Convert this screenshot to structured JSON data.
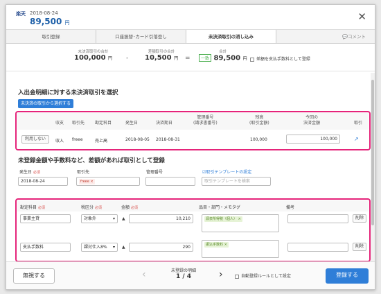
{
  "header": {
    "bank": "楽天",
    "date": "2018-08-24",
    "amount": "89,500",
    "unit": "円"
  },
  "tabs": [
    "取引登録",
    "口座振替･カード引落登し",
    "未決済取引の消し込み",
    "コメント"
  ],
  "summary": {
    "l1": "未決済取引の合計",
    "v1": "100,000",
    "l2": "差額取引の合計",
    "v2": "10,500",
    "l3": "合計",
    "v3": "89,500",
    "badge": "一致",
    "unit": "円",
    "op_minus": "-",
    "op_eq": "=",
    "check": "差額を支払手数料として登録"
  },
  "section1": {
    "title": "入出金明細に対する未決済取引を選択",
    "select_button": "未決済の取引から選択する",
    "columns": [
      "収支",
      "取引先",
      "勘定科目",
      "発生日",
      "決済期日",
      "管理番号\n(請求書番号)",
      "残高\n(取引金額)",
      "今回の\n決済金額",
      "取引"
    ],
    "row": {
      "use_button": "利用しない",
      "type": "収入",
      "partner": "freee",
      "account": "売上高",
      "date": "2018-08-05",
      "due": "2018-08-31",
      "mgmt": "",
      "balance": "100,000",
      "amount": "100,000"
    }
  },
  "section2": {
    "title": "未登録金額や手数料など、差額があれば取引として登録",
    "date_label": "発生日",
    "required": "必須",
    "partner_label": "取引先",
    "mgmt_label": "管理番号",
    "template_link": "取引テンプレートの設定",
    "date_value": "2018-08-24",
    "partner_tag": "freee",
    "template_placeholder": "取引テンプレートを検索",
    "columns": [
      "勘定科目",
      "税区分",
      "金額",
      "品目・部門・メモタグ",
      "備考"
    ],
    "rows": [
      {
        "account": "事業主貸",
        "tax": "対象外",
        "amount": "10,210",
        "tag": "源泉所得税（個人）",
        "delete": "削除"
      },
      {
        "account": "支払手数料",
        "tax": "課対仕入8%",
        "amount": "290",
        "tag": "振込手数料",
        "delete": "削除"
      }
    ]
  },
  "footer": {
    "ignore": "無視する",
    "unreg_label": "未登録の明細",
    "page": "1 / 4",
    "auto_rule": "自動登録ルールとして設定",
    "register": "登録する"
  },
  "colors": {
    "accent": "#2f7ed8",
    "highlight": "#e5247a",
    "amount": "#1d5fa8"
  }
}
